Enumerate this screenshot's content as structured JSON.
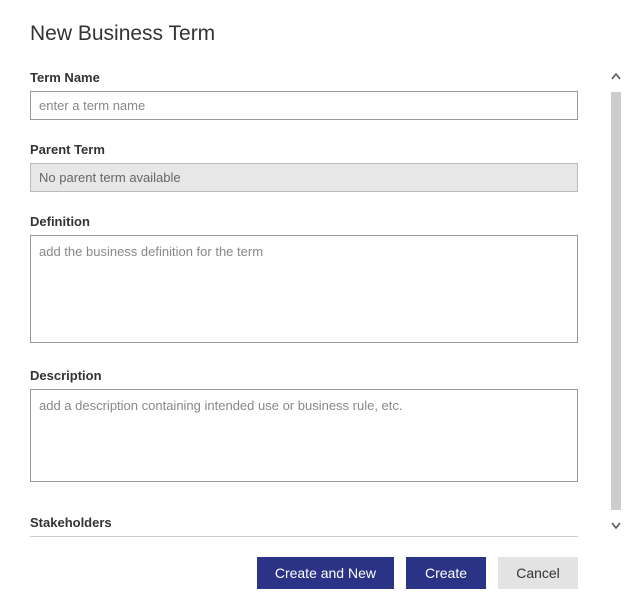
{
  "title": "New Business Term",
  "fields": {
    "termName": {
      "label": "Term Name",
      "placeholder": "enter a term name",
      "value": ""
    },
    "parentTerm": {
      "label": "Parent Term",
      "text": "No parent term available"
    },
    "definition": {
      "label": "Definition",
      "placeholder": "add the business definition for the term",
      "value": ""
    },
    "description": {
      "label": "Description",
      "placeholder": "add a description containing intended use or business rule, etc.",
      "value": ""
    },
    "stakeholders": {
      "label": "Stakeholders"
    }
  },
  "buttons": {
    "createAndNew": "Create and New",
    "create": "Create",
    "cancel": "Cancel"
  }
}
